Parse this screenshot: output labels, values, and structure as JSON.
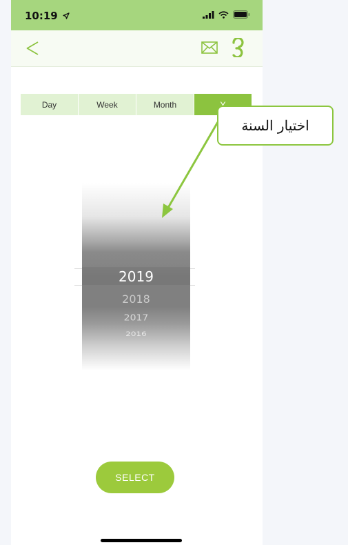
{
  "status_bar": {
    "time": "10:19"
  },
  "segments": [
    {
      "label": "Day",
      "active": false
    },
    {
      "label": "Week",
      "active": false
    },
    {
      "label": "Month",
      "active": false
    },
    {
      "label": "Y",
      "active": true
    }
  ],
  "picker": {
    "selected": "2019",
    "items": [
      "2019",
      "2018",
      "2017",
      "2016"
    ]
  },
  "select_button": {
    "label": "SELECT"
  },
  "annotation": {
    "label": "اختيار السنة"
  },
  "colors": {
    "accent": "#8cc33f",
    "status_bar": "#a6d67e",
    "segment_bg": "#e1f2d3",
    "select_button": "#9cca3c",
    "callout_border": "#8cc63f"
  },
  "icons": [
    "back-arrow-icon",
    "mail-icon",
    "refresh-icon",
    "signal-icon",
    "wifi-icon",
    "battery-icon",
    "location-arrow-icon"
  ]
}
